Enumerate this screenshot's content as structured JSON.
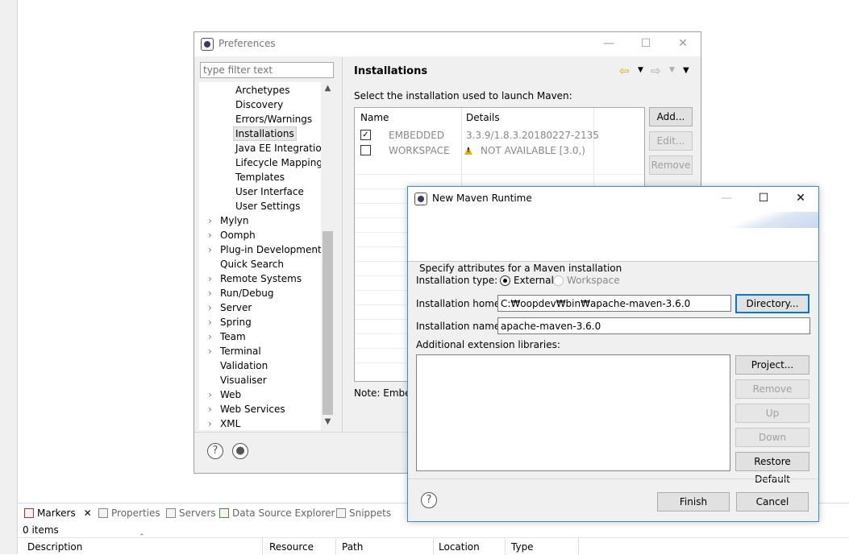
{
  "preferences": {
    "title": "Preferences",
    "filter_placeholder": "type filter text",
    "tree_items": [
      {
        "label": "Archetypes"
      },
      {
        "label": "Discovery"
      },
      {
        "label": "Errors/Warnings"
      },
      {
        "label": "Installations",
        "selected": true
      },
      {
        "label": "Java EE Integration"
      },
      {
        "label": "Lifecycle Mappings"
      },
      {
        "label": "Templates"
      },
      {
        "label": "User Interface"
      },
      {
        "label": "User Settings"
      },
      {
        "label": "Mylyn",
        "expandable": true
      },
      {
        "label": "Oomph",
        "expandable": true
      },
      {
        "label": "Plug-in Development",
        "expandable": true
      },
      {
        "label": "Quick Search"
      },
      {
        "label": "Remote Systems",
        "expandable": true
      },
      {
        "label": "Run/Debug",
        "expandable": true
      },
      {
        "label": "Server",
        "expandable": true
      },
      {
        "label": "Spring",
        "expandable": true
      },
      {
        "label": "Team",
        "expandable": true
      },
      {
        "label": "Terminal",
        "expandable": true
      },
      {
        "label": "Validation"
      },
      {
        "label": "Visualiser"
      },
      {
        "label": "Web",
        "expandable": true
      },
      {
        "label": "Web Services",
        "expandable": true
      },
      {
        "label": "XML",
        "expandable": true
      }
    ],
    "page_title": "Installations",
    "description": "Select the installation used to launch Maven:",
    "table": {
      "columns": [
        "Name",
        "Details"
      ],
      "rows": [
        {
          "checked": true,
          "name": "EMBEDDED",
          "details": "3.3.9/1.8.3.20180227-2135",
          "warning": false
        },
        {
          "checked": false,
          "name": "WORKSPACE",
          "details": "NOT AVAILABLE [3.0,)",
          "warning": true
        }
      ]
    },
    "buttons": {
      "add": "Add...",
      "edit": "Edit...",
      "remove": "Remove"
    },
    "note": "Note: Embed",
    "help_glyph": "?"
  },
  "dialog": {
    "title": "New Maven Runtime",
    "description": "Specify attributes for a Maven installation",
    "installation_type_label": "Installation type:",
    "type_external": "External",
    "type_workspace": "Workspace",
    "installation_home_label": "Installation home:",
    "installation_home_value": "C:₩oopdev₩bin₩apache-maven-3.6.0",
    "directory_button": "Directory...",
    "installation_name_label": "Installation name:",
    "installation_name_value": "apache-maven-3.6.0",
    "ext_libraries_label": "Additional extension libraries:",
    "side_buttons": {
      "project": "Project...",
      "remove": "Remove",
      "up": "Up",
      "down": "Down",
      "restore": "Restore Default"
    },
    "finish": "Finish",
    "cancel": "Cancel",
    "help_glyph": "?"
  },
  "markers_panel": {
    "tabs": [
      {
        "label": "Markers",
        "active": true
      },
      {
        "label": "Properties"
      },
      {
        "label": "Servers"
      },
      {
        "label": "Data Source Explorer"
      },
      {
        "label": "Snippets"
      }
    ],
    "close_glyph": "✕",
    "items_count": "0 items",
    "columns": [
      "Description",
      "Resource",
      "Path",
      "Location",
      "Type"
    ]
  },
  "window_glyphs": {
    "minimize": "—",
    "maximize": "☐",
    "close": "✕"
  }
}
